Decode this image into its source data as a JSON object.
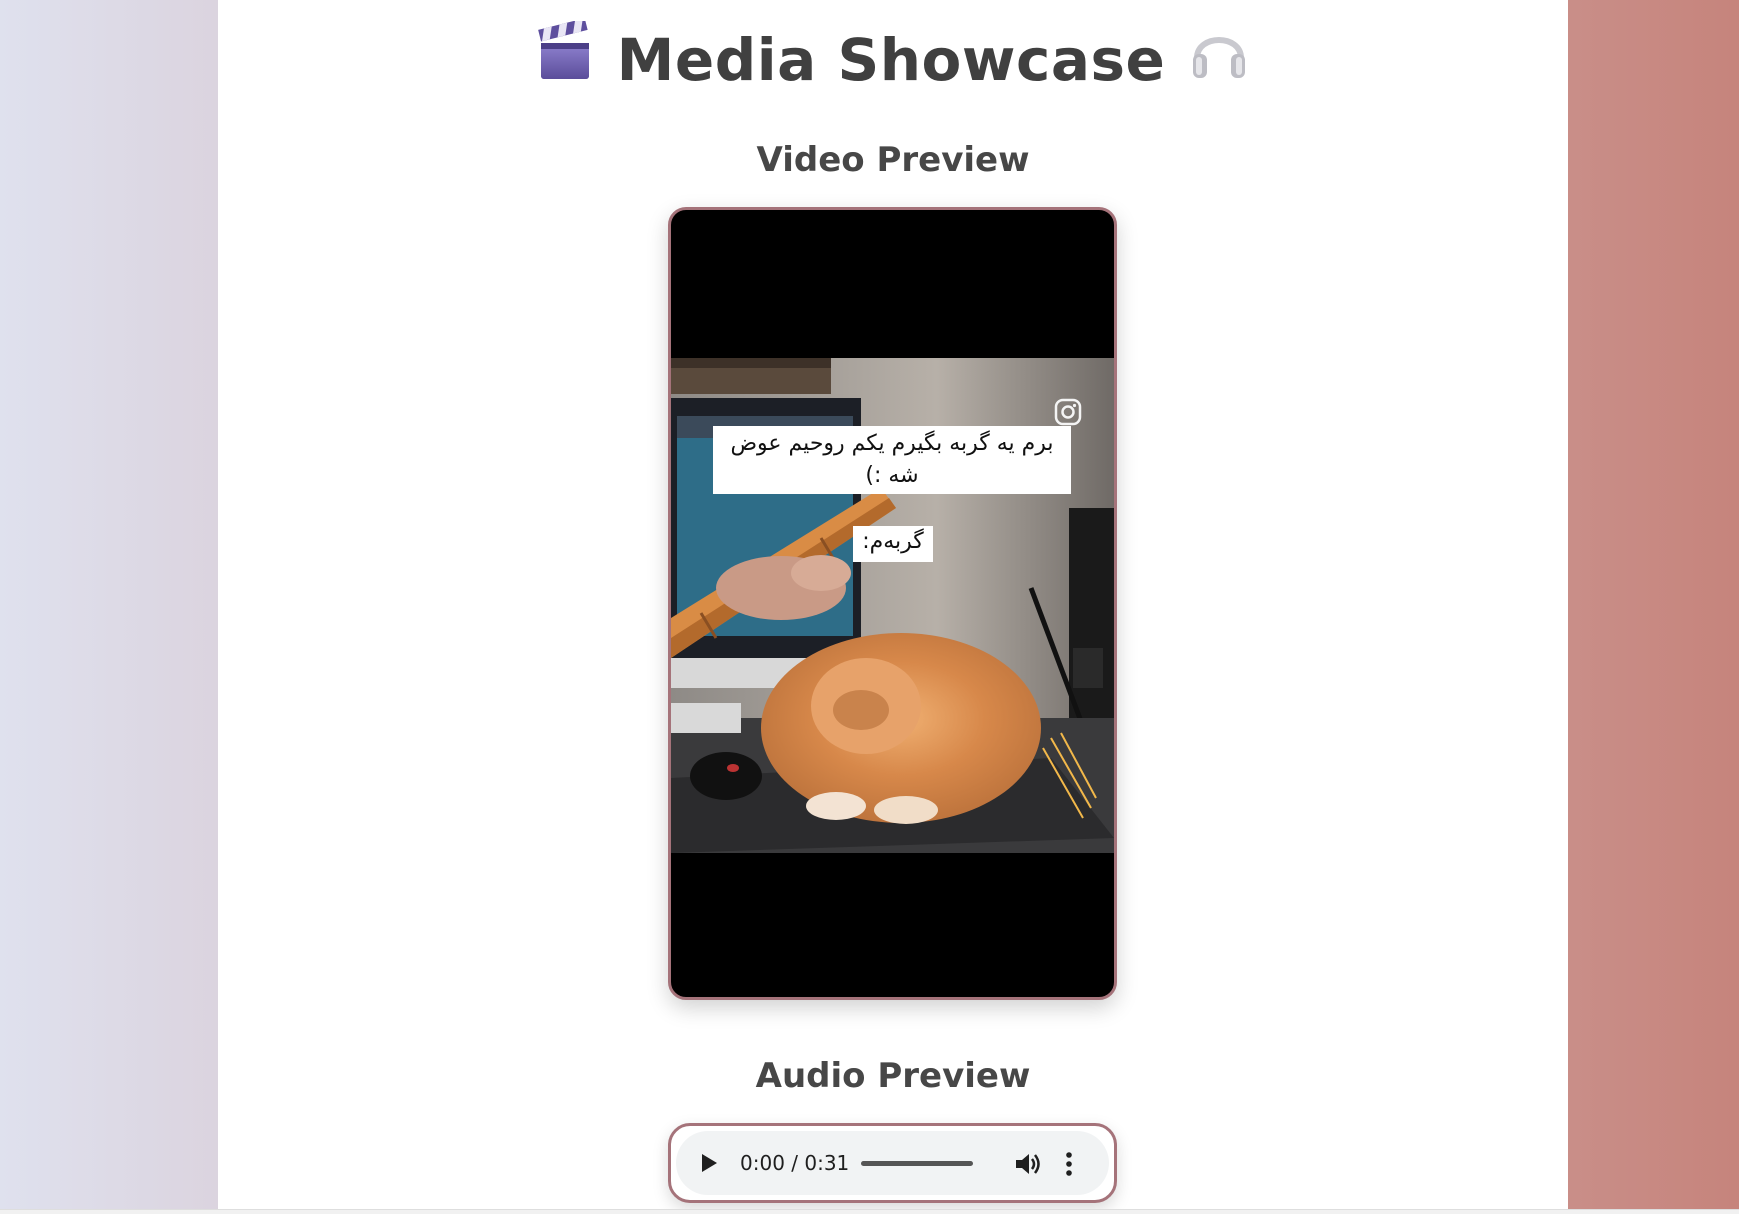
{
  "header": {
    "title": "Media Showcase",
    "left_emoji": "clapper-board-icon",
    "right_emoji": "headphones-icon"
  },
  "video_section": {
    "heading": "Video Preview",
    "caption_main": "برم یه گربه بگیرم یکم روحیم عوض شه :)",
    "caption_small": "گربه‌م:",
    "watermark_icon": "instagram-icon"
  },
  "audio_section": {
    "heading": "Audio Preview",
    "time_display": "0:00 / 0:31",
    "controls": [
      "play-icon",
      "volume-icon",
      "more-vert-icon"
    ]
  },
  "colors": {
    "frame_border": "#a5737a",
    "heading_text": "#474747",
    "player_bg": "#f1f3f4"
  }
}
